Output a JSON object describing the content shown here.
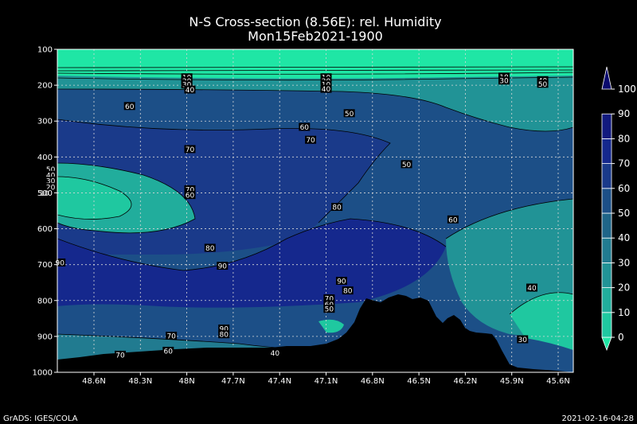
{
  "chart_data": {
    "type": "contour",
    "title": "N-S Cross-section (8.56E): rel. Humidity",
    "subtitle": "Mon15Feb2021-1900",
    "x_ticks": [
      "48.6N",
      "48.3N",
      "48N",
      "47.7N",
      "47.4N",
      "47.1N",
      "46.8N",
      "46.5N",
      "46.2N",
      "45.9N",
      "45.6N"
    ],
    "y_ticks": [
      "100",
      "200",
      "300",
      "400",
      "500",
      "600",
      "700",
      "800",
      "900",
      "1000"
    ],
    "ylim": [
      100,
      1000
    ],
    "grid": true,
    "colorbar": {
      "ticks": [
        "0",
        "10",
        "20",
        "30",
        "40",
        "50",
        "60",
        "70",
        "80",
        "90",
        "100"
      ],
      "colors": [
        "#1fe6a5",
        "#1fc8a0",
        "#21ad9c",
        "#219396",
        "#217b90",
        "#1f6588",
        "#1c4f87",
        "#1a3a8a",
        "#15288d",
        "#121a7e",
        "#0a0a6e"
      ]
    },
    "contour_labels": [
      {
        "text": "10",
        "x": 48.0,
        "y": 178
      },
      {
        "text": "20",
        "x": 48.0,
        "y": 188
      },
      {
        "text": "30",
        "x": 48.0,
        "y": 198
      },
      {
        "text": "40",
        "x": 47.98,
        "y": 212
      },
      {
        "text": "10",
        "x": 47.1,
        "y": 178
      },
      {
        "text": "20",
        "x": 47.1,
        "y": 188
      },
      {
        "text": "10",
        "x": 47.1,
        "y": 198
      },
      {
        "text": "40",
        "x": 47.1,
        "y": 210
      },
      {
        "text": "10",
        "x": 45.95,
        "y": 176
      },
      {
        "text": "30",
        "x": 45.95,
        "y": 187
      },
      {
        "text": "40",
        "x": 45.7,
        "y": 186
      },
      {
        "text": "50",
        "x": 45.7,
        "y": 196
      },
      {
        "text": "60",
        "x": 48.37,
        "y": 258
      },
      {
        "text": "50",
        "x": 46.95,
        "y": 278
      },
      {
        "text": "60",
        "x": 47.24,
        "y": 316
      },
      {
        "text": "70",
        "x": 47.2,
        "y": 352
      },
      {
        "text": "70",
        "x": 47.98,
        "y": 378
      },
      {
        "text": "50",
        "x": 46.58,
        "y": 420
      },
      {
        "text": "50",
        "x": 48.88,
        "y": 434
      },
      {
        "text": "40",
        "x": 48.88,
        "y": 450
      },
      {
        "text": "30",
        "x": 48.88,
        "y": 466
      },
      {
        "text": "20",
        "x": 48.88,
        "y": 484
      },
      {
        "text": "10",
        "x": 48.92,
        "y": 500
      },
      {
        "text": "70",
        "x": 47.98,
        "y": 490
      },
      {
        "text": "60",
        "x": 47.98,
        "y": 506
      },
      {
        "text": "80",
        "x": 47.03,
        "y": 539
      },
      {
        "text": "60",
        "x": 46.28,
        "y": 574
      },
      {
        "text": "80",
        "x": 47.85,
        "y": 653
      },
      {
        "text": "90",
        "x": 48.82,
        "y": 694
      },
      {
        "text": "90",
        "x": 47.77,
        "y": 703
      },
      {
        "text": "90",
        "x": 47.0,
        "y": 745
      },
      {
        "text": "80",
        "x": 46.96,
        "y": 772
      },
      {
        "text": "70",
        "x": 47.08,
        "y": 794
      },
      {
        "text": "60",
        "x": 47.08,
        "y": 810
      },
      {
        "text": "50",
        "x": 47.08,
        "y": 823
      },
      {
        "text": "40",
        "x": 45.77,
        "y": 764
      },
      {
        "text": "90",
        "x": 47.76,
        "y": 878
      },
      {
        "text": "80",
        "x": 47.76,
        "y": 894
      },
      {
        "text": "70",
        "x": 48.1,
        "y": 898
      },
      {
        "text": "30",
        "x": 45.83,
        "y": 908
      },
      {
        "text": "60",
        "x": 48.12,
        "y": 940
      },
      {
        "text": "70",
        "x": 48.43,
        "y": 951
      },
      {
        "text": "40",
        "x": 47.43,
        "y": 946
      }
    ]
  },
  "footer": {
    "left": "GrADS: IGES/COLA",
    "right": "2021-02-16-04:28"
  }
}
